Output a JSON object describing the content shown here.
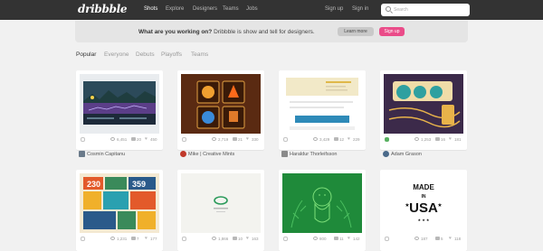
{
  "nav": {
    "logo": "dribbble",
    "links": [
      "Shots",
      "Explore",
      "Designers",
      "Teams",
      "Jobs"
    ],
    "sign_up": "Sign up",
    "sign_in": "Sign in",
    "search_placeholder": "Search"
  },
  "banner": {
    "question": "What are you working on?",
    "tagline": "Dribbble is show and tell for designers.",
    "learn_more": "Learn more",
    "sign_up": "Sign up"
  },
  "filters": [
    "Popular",
    "Everyone",
    "Debuts",
    "Playoffs",
    "Teams"
  ],
  "shots": [
    {
      "views": "6,451",
      "comments": "20",
      "likes": "450",
      "author": "Cosmin Capitanu"
    },
    {
      "views": "2,719",
      "comments": "21",
      "likes": "330",
      "author": "Mike | Creative Mints"
    },
    {
      "views": "3,429",
      "comments": "12",
      "likes": "229",
      "author": "Haraldur Thorleifsson"
    },
    {
      "views": "1,253",
      "comments": "16",
      "likes": "181",
      "author": "Adam Grason"
    },
    {
      "views": "1,231",
      "comments": "7",
      "likes": "177",
      "author": ""
    },
    {
      "views": "1,866",
      "comments": "10",
      "likes": "163",
      "author": ""
    },
    {
      "views": "800",
      "comments": "11",
      "likes": "142",
      "author": ""
    },
    {
      "views": "187",
      "comments": "5",
      "likes": "118",
      "author": ""
    }
  ],
  "shot8_text": [
    "MADE",
    "IN",
    "USA"
  ],
  "colors": {
    "accent": "#ea4c89",
    "nav_bg": "#333333",
    "page_bg": "#f1f1f1"
  }
}
